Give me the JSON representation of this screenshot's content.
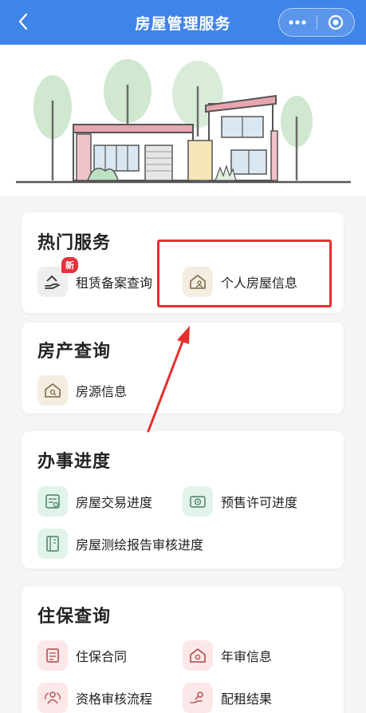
{
  "nav": {
    "title": "房屋管理服务",
    "back_icon": "chevron-left-icon",
    "more_icon": "more-dots-icon",
    "close_icon": "target-circle-icon",
    "bar_color": "#3f84e9"
  },
  "banner": {
    "illustration": "house-with-trees"
  },
  "sections": {
    "hot": {
      "title": "热门服务",
      "items": [
        {
          "label": "租赁备案查询",
          "icon": "hand-house-icon",
          "badge": "新"
        },
        {
          "label": "个人房屋信息",
          "icon": "house-person-icon"
        }
      ]
    },
    "property": {
      "title": "房产查询",
      "items": [
        {
          "label": "房源信息",
          "icon": "house-search-icon"
        }
      ]
    },
    "progress": {
      "title": "办事进度",
      "items": [
        {
          "label": "房屋交易进度",
          "icon": "transaction-doc-icon"
        },
        {
          "label": "预售许可进度",
          "icon": "permit-card-icon"
        },
        {
          "label": "房屋测绘报告审核进度",
          "icon": "survey-report-icon"
        }
      ]
    },
    "housing": {
      "title": "住保查询",
      "items": [
        {
          "label": "住保合同",
          "icon": "contract-doc-icon"
        },
        {
          "label": "年审信息",
          "icon": "house-check-icon"
        },
        {
          "label": "资格审核流程",
          "icon": "people-flow-icon"
        },
        {
          "label": "配租结果",
          "icon": "hand-key-icon"
        }
      ]
    }
  },
  "annotation": {
    "highlight_color": "#e5302c"
  }
}
